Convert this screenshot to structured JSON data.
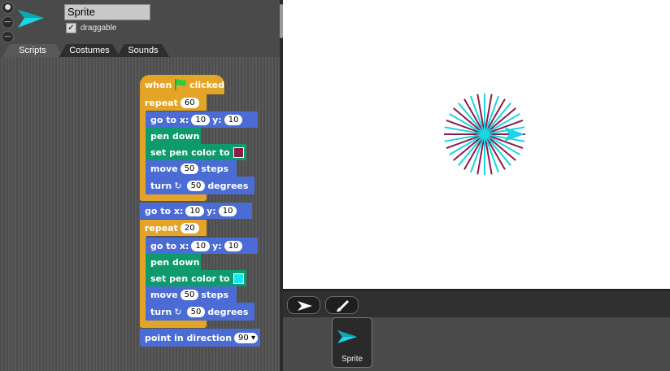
{
  "sprite": {
    "name": "Sprite",
    "draggable_label": "draggable",
    "draggable_checked": "✓"
  },
  "tabs": [
    {
      "label": "Scripts"
    },
    {
      "label": "Costumes"
    },
    {
      "label": "Sounds"
    }
  ],
  "script": {
    "hat": {
      "when": "when",
      "clicked": "clicked"
    },
    "repeat1": {
      "label": "repeat",
      "count": "60"
    },
    "goto": {
      "label": "go to x:",
      "ylabel": "y:",
      "x": "10",
      "y": "10"
    },
    "pen_down": "pen down",
    "set_pen_color": "set pen color to",
    "move": {
      "label": "move",
      "steps": "50",
      "suffix": "steps"
    },
    "turn": {
      "label": "turn",
      "degrees": "50",
      "suffix": "degrees"
    },
    "repeat2": {
      "label": "repeat",
      "count": "20"
    },
    "point": {
      "label": "point in direction",
      "value": "90"
    }
  },
  "colors": {
    "pen_color_1": "#8b1c4a",
    "pen_color_2": "#18d6e2",
    "sprite_arrow": "#18d6e2"
  },
  "corral": {
    "sprite_label": "Sprite"
  }
}
